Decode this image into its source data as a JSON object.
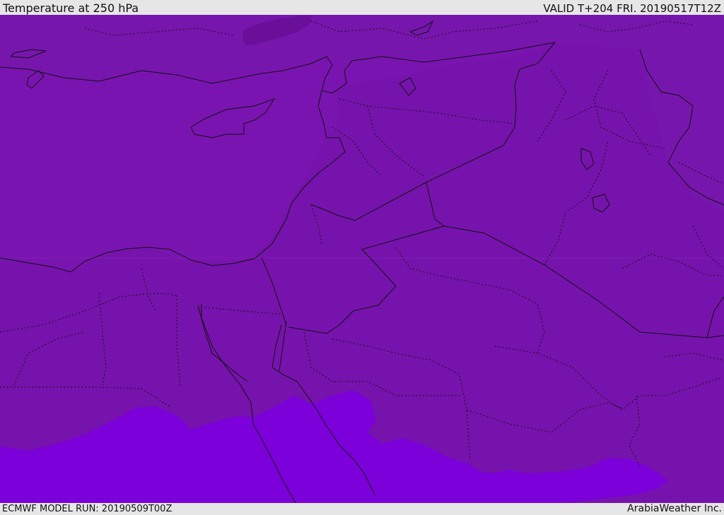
{
  "header": {
    "title": "Temperature at 250 hPa",
    "valid_time": "VALID T+204 FRI. 20190517T12Z"
  },
  "footer": {
    "model_run": "ECMWF MODEL RUN: 20190509T00Z",
    "credit": "ArabiaWeather Inc."
  },
  "map": {
    "colors": {
      "sea_band": "#7b14b3",
      "land_band": "#7513ab",
      "warm_band": "#7c00d9",
      "cold_patch": "#6a0f9a",
      "coastline": "#111111",
      "border": "#111111"
    }
  }
}
